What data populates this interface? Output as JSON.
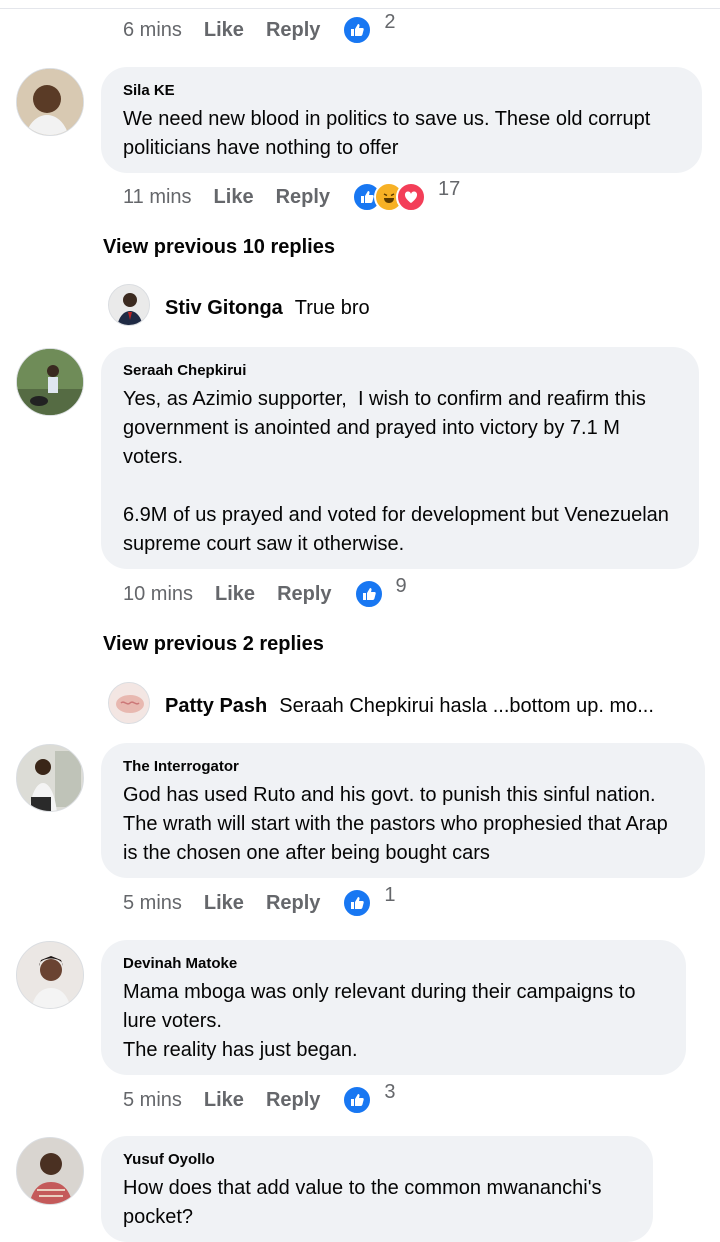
{
  "actions": {
    "like": "Like",
    "reply": "Reply"
  },
  "colors": {
    "like": "#1877f2",
    "haha": "#f7b125",
    "love": "#f33e58",
    "bubble": "#f0f2f5",
    "meta": "#65676b"
  },
  "top_meta": {
    "time": "6 mins",
    "reactions": [
      "like"
    ],
    "count": "2"
  },
  "comments": [
    {
      "author": "Sila KE",
      "text": "We need new blood in politics to save us. These old corrupt politicians have nothing to offer",
      "time": "11 mins",
      "reactions": [
        "like",
        "haha",
        "love"
      ],
      "count": "17",
      "view_previous": "View previous 10 replies",
      "reply": {
        "author": "Stiv Gitonga",
        "text": "True bro"
      }
    },
    {
      "author": "Seraah Chepkirui",
      "text": "Yes, as Azimio supporter,  I wish to confirm and reafirm this government is anointed and prayed into victory by 7.1 M voters.\n\n6.9M of us prayed and voted for development but Venezuelan supreme court saw it otherwise.",
      "time": "10 mins",
      "reactions": [
        "like"
      ],
      "count": "9",
      "view_previous": "View previous 2 replies",
      "reply": {
        "author": "Patty Pash",
        "text": "Seraah Chepkirui hasla ...bottom up.  mo..."
      }
    },
    {
      "author": "The Interrogator",
      "text": "God has used Ruto and his govt. to punish this sinful nation. The wrath will start with the pastors who prophesied that Arap is the chosen one after being bought cars",
      "time": "5 mins",
      "reactions": [
        "like"
      ],
      "count": "1"
    },
    {
      "author": "Devinah Matoke",
      "text": "Mama mboga was only relevant during their campaigns to lure voters.\nThe reality has just began.",
      "time": "5 mins",
      "reactions": [
        "like"
      ],
      "count": "3"
    },
    {
      "author": "Yusuf Oyollo",
      "text": "How does that add value to the common mwananchi's pocket?"
    }
  ]
}
